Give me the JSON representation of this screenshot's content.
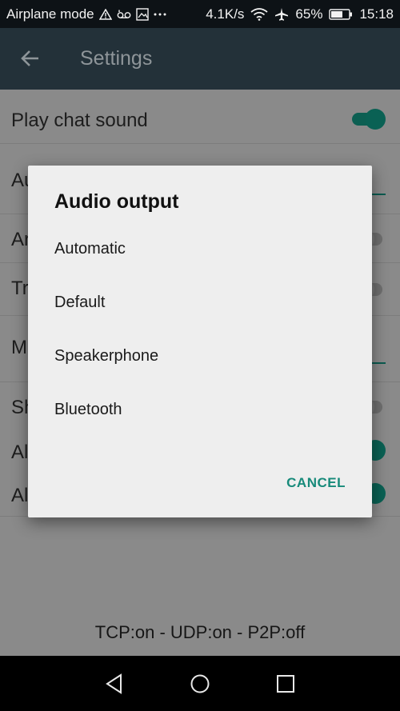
{
  "status_bar": {
    "carrier": "Airplane mode",
    "net_speed": "4.1K/s",
    "battery": "65%",
    "time": "15:18",
    "icons": [
      "warning-icon",
      "voicemail-icon",
      "image-icon",
      "more-icon",
      "wifi-icon",
      "airplane-icon",
      "battery-icon"
    ]
  },
  "app_bar": {
    "title": "Settings"
  },
  "settings": {
    "rows": [
      {
        "label": "Play chat sound",
        "control": "toggle-on"
      },
      {
        "label": "Au",
        "control": "underline"
      },
      {
        "label": "Ar",
        "control": "toggle-off"
      },
      {
        "label": "Tr",
        "control": "toggle-off"
      },
      {
        "label": "M",
        "control": "underline"
      },
      {
        "label": "Sh",
        "control": "toggle-off"
      },
      {
        "label": "Al",
        "control": "toggle-on"
      },
      {
        "label": "Al",
        "control": "toggle-on"
      }
    ]
  },
  "dialog": {
    "title": "Audio output",
    "options": [
      "Automatic",
      "Default",
      "Speakerphone",
      "Bluetooth"
    ],
    "cancel_label": "CANCEL"
  },
  "footer": {
    "connection_status": "TCP:on - UDP:on - P2P:off"
  },
  "colors": {
    "accent": "#178a7a",
    "app_bar": "#233139",
    "scrim_bg": "#8a8a8a"
  }
}
